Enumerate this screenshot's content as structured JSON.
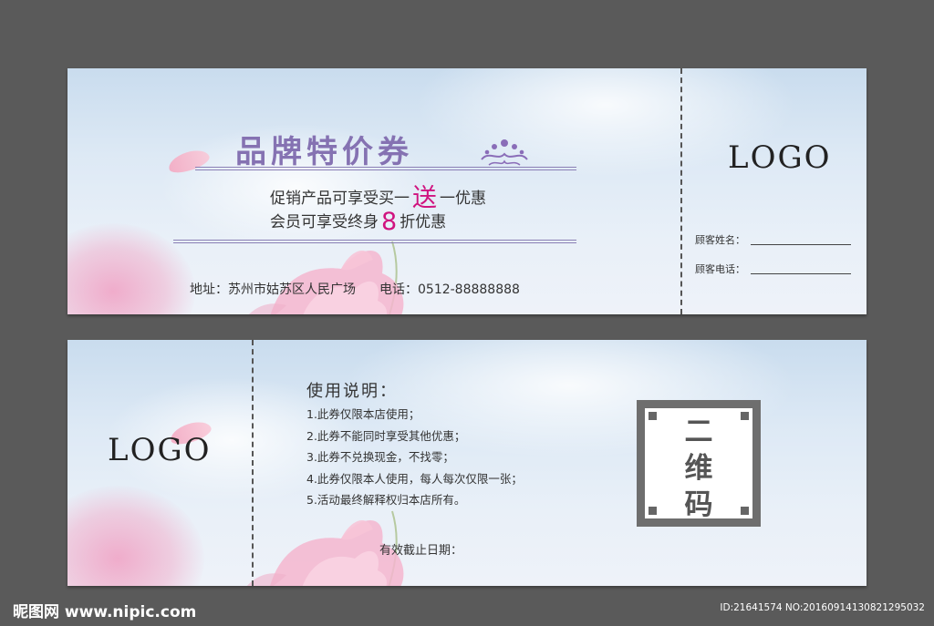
{
  "front": {
    "title": "品牌特价券",
    "promo1_pre": "促销产品可享受买一",
    "promo1_accent": "送",
    "promo1_post": "一优惠",
    "promo2_pre": "会员可享受终身",
    "promo2_accent": "8",
    "promo2_post": "折优惠",
    "address": "地址：苏州市姑苏区人民广场",
    "phone": "电话：0512-88888888",
    "stub_logo": "LOGO",
    "customer_name_label": "顾客姓名：",
    "customer_phone_label": "顾客电话："
  },
  "back": {
    "logo": "LOGO",
    "instructions_title": "使用说明：",
    "instructions": [
      "1.此券仅限本店使用；",
      "2.此券不能同时享受其他优惠；",
      "3.此券不兑换现金，不找零；",
      "4.此券仅限本人使用，每人每次仅限一张；",
      "5.活动最终解释权归本店所有。"
    ],
    "expiry_label": "有效截止日期：",
    "qr_lines": [
      "二",
      "维",
      "码"
    ]
  },
  "watermark": {
    "left": "昵图网 www.nipic.com",
    "right": "ID:21641574 NO:20160914130821295032"
  },
  "colors": {
    "background": "#5a5a5a",
    "title": "#8572b2",
    "accent": "#d0137f",
    "qr_border": "#6e6e6e"
  }
}
